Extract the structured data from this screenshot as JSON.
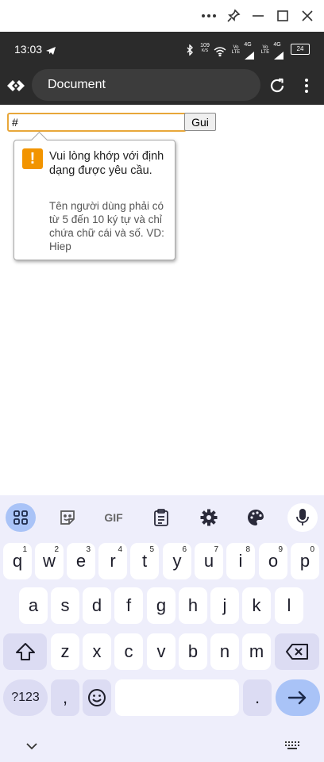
{
  "status_bar": {
    "time": "13:03",
    "net_speed_value": "109",
    "net_speed_unit": "K/S",
    "sim1_label_top": "Vo",
    "sim1_label_bottom": "LTE",
    "sim1_network": "4G",
    "sim2_label_top": "Vo",
    "sim2_label_bottom": "LTE",
    "sim2_network": "4G",
    "battery": "24"
  },
  "browser": {
    "tab_title": "Document"
  },
  "form": {
    "username_value": "#",
    "submit_label": "Gui"
  },
  "validation_tooltip": {
    "message": "Vui lòng khớp với định dạng được yêu cầu.",
    "detail": "Tên người dùng phải có từ 5 đến 10 ký tự và chỉ chứa chữ cái và số. VD: Hiep"
  },
  "keyboard": {
    "toolbar": {
      "gif_label": "GIF"
    },
    "row1": [
      {
        "key": "q",
        "hint": "1"
      },
      {
        "key": "w",
        "hint": "2"
      },
      {
        "key": "e",
        "hint": "3"
      },
      {
        "key": "r",
        "hint": "4"
      },
      {
        "key": "t",
        "hint": "5"
      },
      {
        "key": "y",
        "hint": "6"
      },
      {
        "key": "u",
        "hint": "7"
      },
      {
        "key": "i",
        "hint": "8"
      },
      {
        "key": "o",
        "hint": "9"
      },
      {
        "key": "p",
        "hint": "0"
      }
    ],
    "row2": [
      "a",
      "s",
      "d",
      "f",
      "g",
      "h",
      "j",
      "k",
      "l"
    ],
    "row3": [
      "z",
      "x",
      "c",
      "v",
      "b",
      "n",
      "m"
    ],
    "symbols_label": "?123",
    "comma_label": ",",
    "period_label": "."
  },
  "colors": {
    "input_focus_border": "#e8a73a",
    "warning_icon": "#f29400",
    "keyboard_background": "#eeeefb",
    "enter_key": "#a9c3f7"
  }
}
